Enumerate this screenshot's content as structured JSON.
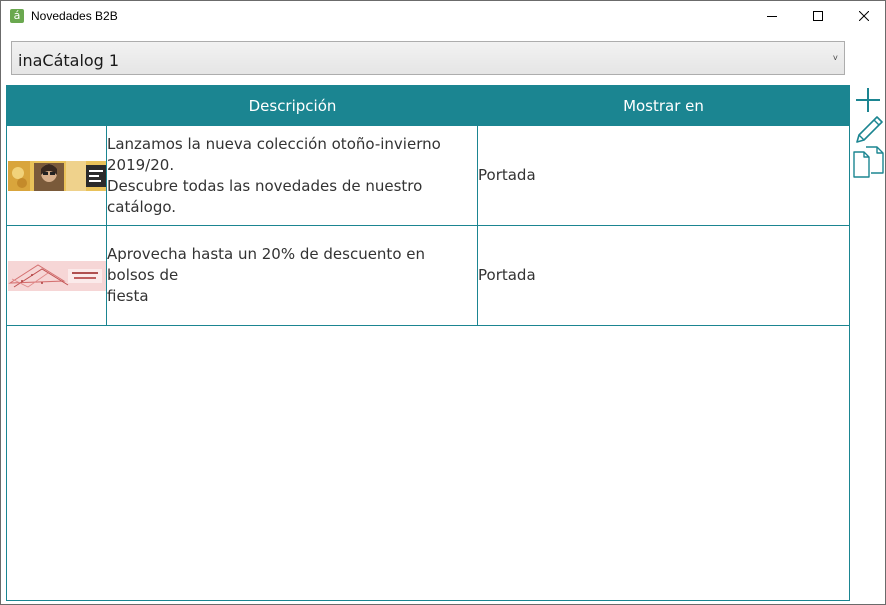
{
  "window": {
    "title": "Novedades B2B",
    "app_icon_glyph": "á"
  },
  "catalog_select": {
    "value": "inaCátalog 1",
    "arrow": "˅"
  },
  "grid": {
    "columns": [
      "",
      "Descripción",
      "Mostrar en"
    ],
    "rows": [
      {
        "thumbnail": "autumn-collection-banner",
        "description": "Lanzamos la nueva colección otoño-invierno\n2019/20.\nDescubre todas las novedades de nuestro catálogo.",
        "show_in": "Portada"
      },
      {
        "thumbnail": "party-bags-discount-banner",
        "description": "Aprovecha hasta un 20% de descuento en bolsos de\nfiesta",
        "show_in": "Portada"
      }
    ]
  },
  "toolbar": {
    "icons": [
      "add-icon",
      "edit-icon",
      "copy-icon"
    ]
  },
  "colors": {
    "accent": "#1b8591",
    "header_text": "#ffffff",
    "app_icon": "#6aa84f"
  }
}
